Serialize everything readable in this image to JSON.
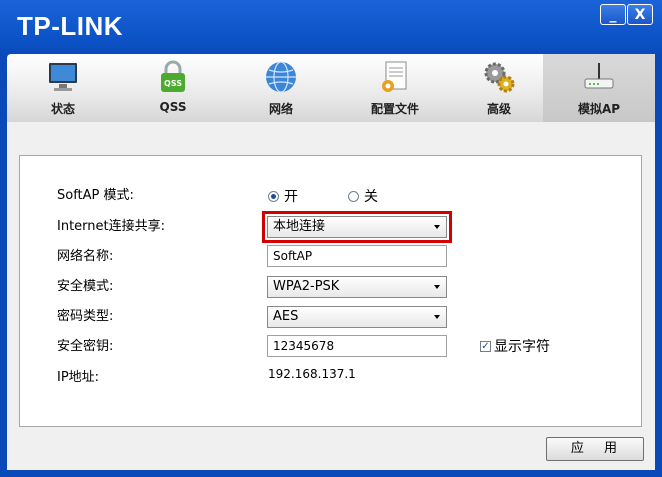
{
  "app": {
    "logo": "TP-LINK",
    "minimize_glyph": "_",
    "close_glyph": "X"
  },
  "tabs": [
    {
      "label": "状态",
      "icon": "monitor-icon"
    },
    {
      "label": "QSS",
      "icon": "lock-qss-icon"
    },
    {
      "label": "网络",
      "icon": "globe-icon"
    },
    {
      "label": "配置文件",
      "icon": "profile-file-icon"
    },
    {
      "label": "高级",
      "icon": "gears-icon"
    },
    {
      "label": "模拟AP",
      "icon": "router-icon",
      "active": true
    }
  ],
  "form": {
    "softap_mode": {
      "label": "SoftAP 模式:",
      "on_label": "开",
      "off_label": "关",
      "selected": "开"
    },
    "internet_share": {
      "label": "Internet连接共享:",
      "value": "本地连接"
    },
    "network_name": {
      "label": "网络名称:",
      "value": "SoftAP"
    },
    "security_mode": {
      "label": "安全模式:",
      "value": "WPA2-PSK"
    },
    "cipher_type": {
      "label": "密码类型:",
      "value": "AES"
    },
    "security_key": {
      "label": "安全密钥:",
      "value": "12345678",
      "show_chars_label": "显示字符",
      "show_chars_checked": true
    },
    "ip_address": {
      "label": "IP地址:",
      "value": "192.168.137.1"
    }
  },
  "apply_button": "应 用",
  "colors": {
    "titlebar": "#0b52c6",
    "highlight": "#d40000"
  }
}
